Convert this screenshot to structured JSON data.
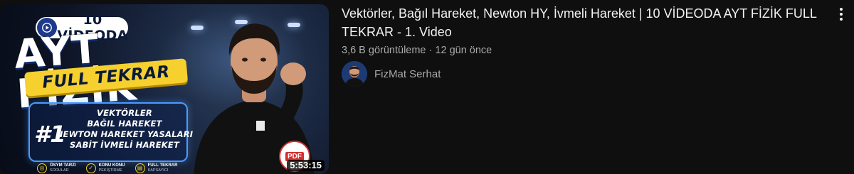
{
  "video": {
    "title": "Vektörler, Bağıl Hareket, Newton HY, İvmeli Hareket | 10 VİDEODA AYT FİZİK FULL TEKRAR - 1. Video",
    "views": "3,6 B görüntüleme",
    "separator": "·",
    "age": "12 gün önce",
    "duration": "5:53:15",
    "more_icon": "more-vert-icon"
  },
  "channel": {
    "name": "FizMat Serhat",
    "avatar_icon": "channel-avatar"
  },
  "thumbnail": {
    "badge": "10 VİDEODA",
    "headline": "AYT FİZİK",
    "ribbon": "FULL TEKRAR",
    "number": "#1",
    "topics": [
      "VEKTÖRLER",
      "BAĞIL HAREKET",
      "NEWTON HAREKET YASALARI",
      "SABİT İVMELİ HAREKET"
    ],
    "features": [
      {
        "line1": "ÖSYM TARZI",
        "line2": "SORULAR"
      },
      {
        "line1": "KONU KONU",
        "line2": "PEKİŞTİRME"
      },
      {
        "line1": "FULL TEKRAR",
        "line2": "KAPSAYICI"
      }
    ],
    "pdf_label": "PDF",
    "colors": {
      "accent_yellow": "#f5d02f",
      "accent_blue": "#4a9bff",
      "pdf_red": "#d32f2f"
    }
  }
}
